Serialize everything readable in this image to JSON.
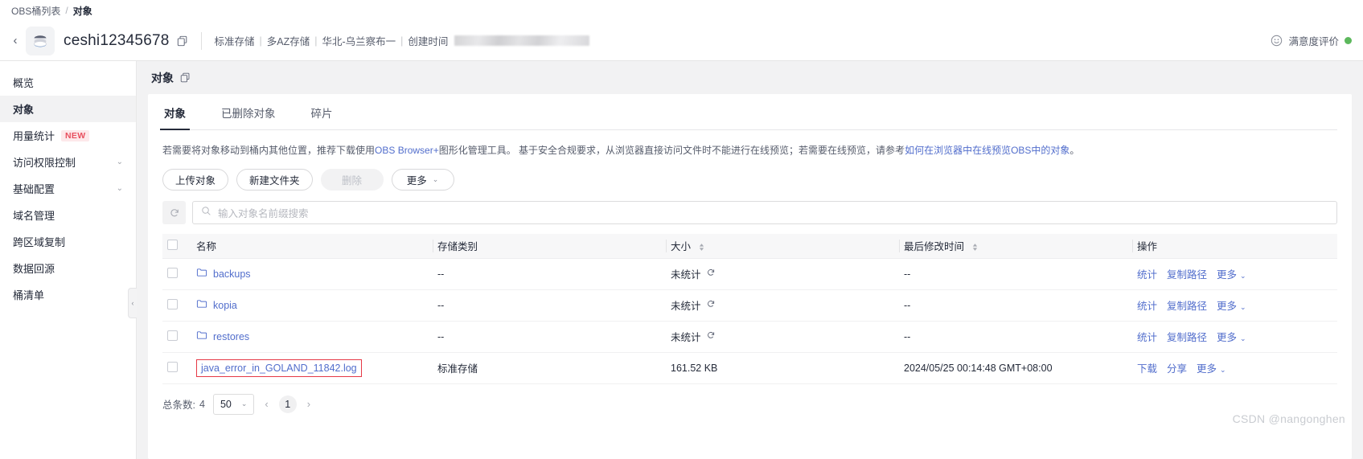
{
  "breadcrumb": {
    "root": "OBS桶列表",
    "separator": "/",
    "current": "对象"
  },
  "bucket": {
    "name": "ceshi12345678",
    "copy_icon": "copy-icon",
    "storage_class": "标准存储",
    "az_mode": "多AZ存储",
    "region": "华北-乌兰察布一",
    "created_label": "创建时间",
    "created_value_redacted": ""
  },
  "header_right": {
    "smile_icon": "smiley-icon",
    "satisfaction": "满意度评价"
  },
  "sidebar": {
    "items": [
      {
        "label": "概览",
        "active": false,
        "expandable": false,
        "badge": ""
      },
      {
        "label": "对象",
        "active": true,
        "expandable": false,
        "badge": ""
      },
      {
        "label": "用量统计",
        "active": false,
        "expandable": false,
        "badge": "NEW"
      },
      {
        "label": "访问权限控制",
        "active": false,
        "expandable": true,
        "badge": ""
      },
      {
        "label": "基础配置",
        "active": false,
        "expandable": true,
        "badge": ""
      },
      {
        "label": "域名管理",
        "active": false,
        "expandable": false,
        "badge": ""
      },
      {
        "label": "跨区域复制",
        "active": false,
        "expandable": false,
        "badge": ""
      },
      {
        "label": "数据回源",
        "active": false,
        "expandable": false,
        "badge": ""
      },
      {
        "label": "桶清单",
        "active": false,
        "expandable": false,
        "badge": ""
      }
    ],
    "collapse_handle": "‹"
  },
  "content": {
    "title": "对象",
    "title_copy_icon": "copy-icon",
    "tabs": [
      {
        "label": "对象",
        "active": true
      },
      {
        "label": "已删除对象",
        "active": false
      },
      {
        "label": "碎片",
        "active": false
      }
    ],
    "notice": {
      "part1": "若需要将对象移动到桶内其他位置，推荐下载使用",
      "link1": "OBS Browser+",
      "part2": "图形化管理工具。 基于安全合规要求，从浏览器直接访问文件时不能进行在线预览；若需要在线预览，请参考",
      "link2": "如何在浏览器中在线预览OBS中的对象",
      "part3": "。"
    },
    "buttons": [
      {
        "label": "上传对象",
        "disabled": false,
        "dropdown": false
      },
      {
        "label": "新建文件夹",
        "disabled": false,
        "dropdown": false
      },
      {
        "label": "删除",
        "disabled": true,
        "dropdown": false
      },
      {
        "label": "更多",
        "disabled": false,
        "dropdown": true
      }
    ],
    "search": {
      "refresh_icon": "refresh-icon",
      "search_icon": "search-icon",
      "placeholder": "输入对象名前缀搜索",
      "value": ""
    },
    "table": {
      "columns": [
        {
          "label": "名称",
          "sortable": false
        },
        {
          "label": "存储类别",
          "sortable": false
        },
        {
          "label": "大小",
          "sortable": true
        },
        {
          "label": "最后修改时间",
          "sortable": true
        },
        {
          "label": "操作",
          "sortable": false
        }
      ],
      "rows": [
        {
          "type": "folder",
          "name": "backups",
          "storage_class": "--",
          "size": "未统计",
          "size_icon": "refresh-stat-icon",
          "modified": "--",
          "ops": [
            "统计",
            "复制路径",
            "更多"
          ],
          "highlighted": false
        },
        {
          "type": "folder",
          "name": "kopia",
          "storage_class": "--",
          "size": "未统计",
          "size_icon": "refresh-stat-icon",
          "modified": "--",
          "ops": [
            "统计",
            "复制路径",
            "更多"
          ],
          "highlighted": false
        },
        {
          "type": "folder",
          "name": "restores",
          "storage_class": "--",
          "size": "未统计",
          "size_icon": "refresh-stat-icon",
          "modified": "--",
          "ops": [
            "统计",
            "复制路径",
            "更多"
          ],
          "highlighted": false
        },
        {
          "type": "file",
          "name": "java_error_in_GOLAND_11842.log",
          "storage_class": "标准存储",
          "size": "161.52 KB",
          "size_icon": "",
          "modified": "2024/05/25 00:14:48 GMT+08:00",
          "ops": [
            "下载",
            "分享",
            "更多"
          ],
          "highlighted": true
        }
      ]
    },
    "footer": {
      "total_label": "总条数:",
      "total_value": "4",
      "page_size": "50",
      "prev": "‹",
      "page": "1",
      "next": "›"
    }
  },
  "watermark": "CSDN @nangonghen",
  "colors": {
    "link": "#526ecc",
    "highlight_border": "#e63946",
    "badge_new_bg": "#fde8ea",
    "badge_new_text": "#e8505f"
  }
}
